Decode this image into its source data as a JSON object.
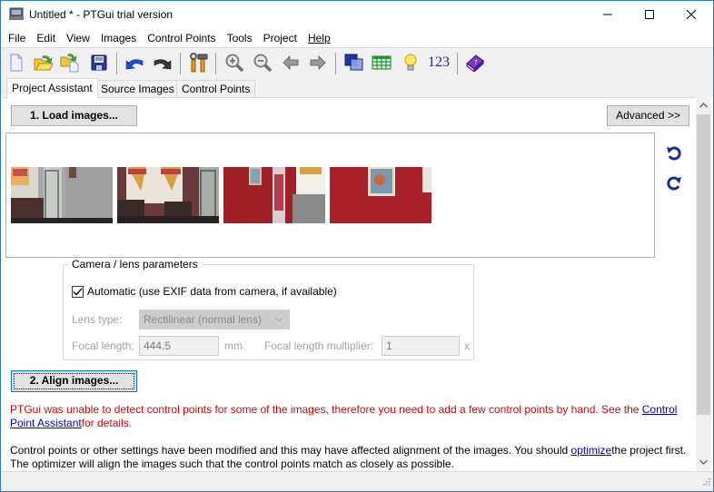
{
  "window": {
    "title": "Untitled * - PTGui trial version",
    "icons": {
      "app": "ptgui-app-icon",
      "minimize": "minimize-icon",
      "maximize": "maximize-icon",
      "close": "close-icon"
    }
  },
  "menu": [
    {
      "label": "File"
    },
    {
      "label": "Edit"
    },
    {
      "label": "View"
    },
    {
      "label": "Images"
    },
    {
      "label": "Control Points"
    },
    {
      "label": "Tools"
    },
    {
      "label": "Project"
    },
    {
      "label": "Help",
      "mnemonic": "H"
    }
  ],
  "toolbar": {
    "buttons": [
      {
        "icon": "new-document-icon",
        "tooltip": "New"
      },
      {
        "icon": "open-folder-icon",
        "tooltip": "Open"
      },
      {
        "icon": "open-recent-icon",
        "tooltip": "Open recent"
      },
      {
        "icon": "save-disk-icon",
        "tooltip": "Save"
      },
      {
        "icon": "undo-icon",
        "tooltip": "Undo"
      },
      {
        "icon": "redo-icon",
        "tooltip": "Redo"
      },
      {
        "icon": "tools-icon",
        "tooltip": "Tools"
      },
      {
        "icon": "zoom-in-icon",
        "tooltip": "Zoom in"
      },
      {
        "icon": "zoom-out-icon",
        "tooltip": "Zoom out"
      },
      {
        "icon": "arrow-left-icon",
        "tooltip": "Previous"
      },
      {
        "icon": "arrow-right-icon",
        "tooltip": "Next"
      },
      {
        "icon": "panorama-editor-icon",
        "tooltip": "Panorama editor"
      },
      {
        "icon": "table-icon",
        "tooltip": "Control point table"
      },
      {
        "icon": "lightbulb-icon",
        "tooltip": "Tips"
      },
      {
        "icon": "numeric-transform-icon",
        "tooltip": "Numerical transform",
        "label": "123"
      },
      {
        "icon": "help-book-icon",
        "tooltip": "Help"
      }
    ]
  },
  "tabs": [
    {
      "label": "Project Assistant",
      "active": true
    },
    {
      "label": "Source Images",
      "active": false,
      "mnemonic": "S"
    },
    {
      "label": "Control Points",
      "active": false,
      "mnemonic": "o"
    }
  ],
  "assistant": {
    "load_button": "1. Load images...",
    "advanced_button": "Advanced >>",
    "images": [
      {
        "name": "image-1",
        "description": "living room with door and curtains"
      },
      {
        "name": "image-2",
        "description": "living room with window and chairs"
      },
      {
        "name": "image-3",
        "description": "red wall with doorway"
      },
      {
        "name": "image-4",
        "description": "red wall with painting"
      }
    ],
    "rotate_left_icon": "rotate-left-icon",
    "rotate_right_icon": "rotate-right-icon",
    "camera": {
      "group_title": "Camera / lens parameters",
      "automatic_label": "Automatic (use EXIF data from camera, if available)",
      "automatic_checked": true,
      "lens_type_label": "Lens type:",
      "lens_type_value": "Rectilinear (normal lens)",
      "focal_length_label": "Focal length:",
      "focal_length_value": "444.5",
      "focal_length_unit": "mm",
      "multiplier_label": "Focal length multiplier:",
      "multiplier_value": "1",
      "multiplier_unit": "x"
    },
    "align_button": "2. Align images...",
    "error_message": {
      "text_before": "PTGui was unable to detect control points for some of the images, therefore you need to add a few control points by hand. See the ",
      "link": "Control Point Assistant",
      "text_after": "for details."
    },
    "info_message": {
      "text_before": "Control points or other settings have been modified and this may have affected alignment of the images. You should ",
      "link": "optimize",
      "text_after": "the project first. The optimizer will align the images such that the control points match as closely as possible."
    }
  },
  "colors": {
    "error_text": "#e00000",
    "link": "#0000cc",
    "window_border": "#2b79c2"
  }
}
